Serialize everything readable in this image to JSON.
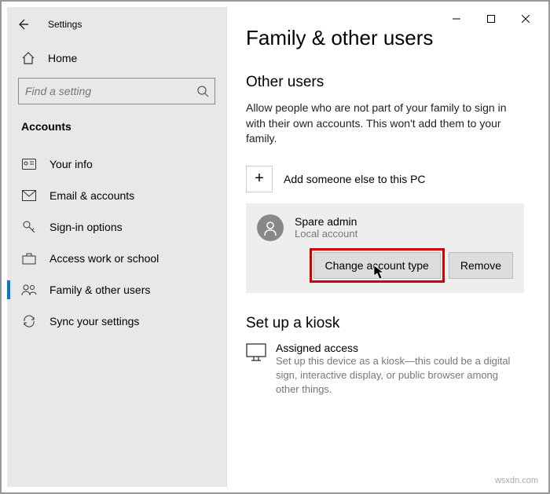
{
  "titlebar": {
    "title": "Settings"
  },
  "sidebar": {
    "home": "Home",
    "search_placeholder": "Find a setting",
    "category": "Accounts",
    "items": [
      {
        "label": "Your info"
      },
      {
        "label": "Email & accounts"
      },
      {
        "label": "Sign-in options"
      },
      {
        "label": "Access work or school"
      },
      {
        "label": "Family & other users"
      },
      {
        "label": "Sync your settings"
      }
    ]
  },
  "main": {
    "heading": "Family & other users",
    "other_users_heading": "Other users",
    "other_users_desc": "Allow people who are not part of your family to sign in with their own accounts. This won't add them to your family.",
    "add_label": "Add someone else to this PC",
    "user": {
      "name": "Spare admin",
      "type": "Local account"
    },
    "change_btn": "Change account type",
    "remove_btn": "Remove",
    "kiosk_heading": "Set up a kiosk",
    "assigned_title": "Assigned access",
    "assigned_desc": "Set up this device as a kiosk—this could be a digital sign, interactive display, or public browser among other things."
  },
  "watermark": "wsxdn.com"
}
